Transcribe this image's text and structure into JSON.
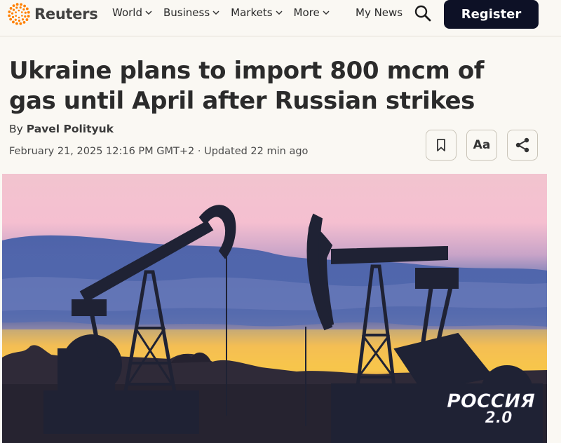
{
  "header": {
    "logo_text": "Reuters",
    "nav": [
      {
        "label": "World"
      },
      {
        "label": "Business"
      },
      {
        "label": "Markets"
      },
      {
        "label": "More"
      }
    ],
    "my_news": "My News",
    "search_icon": "search-icon",
    "register_label": "Register",
    "colors": {
      "brand_orange": "#ff8000",
      "register_bg": "#0d1126"
    }
  },
  "article": {
    "headline": "Ukraine plans to import 800 mcm of gas until April after Russian strikes",
    "byline_prefix": "By",
    "author": "Pavel Polityuk",
    "date": "February 21, 2025 12:16 PM GMT+2",
    "separator": " · ",
    "updated": "Updated 22 min ago",
    "tools": [
      {
        "icon": "bookmark-icon"
      },
      {
        "label": "Aa",
        "icon": "text-size-icon"
      },
      {
        "icon": "share-icon"
      }
    ]
  },
  "hero_image": {
    "subject": "oil pump jacks silhouetted against sunset sky",
    "watermark_line1": "РОССИЯ",
    "watermark_line2": "2.0"
  }
}
